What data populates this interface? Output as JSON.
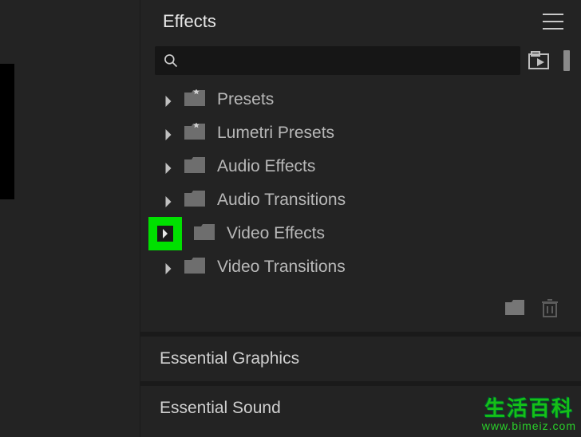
{
  "panel": {
    "title": "Effects",
    "search_placeholder": ""
  },
  "tree": [
    {
      "label": "Presets",
      "icon": "folder-star"
    },
    {
      "label": "Lumetri Presets",
      "icon": "folder-star"
    },
    {
      "label": "Audio Effects",
      "icon": "folder"
    },
    {
      "label": "Audio Transitions",
      "icon": "folder"
    },
    {
      "label": "Video Effects",
      "icon": "folder",
      "highlighted": true
    },
    {
      "label": "Video Transitions",
      "icon": "folder"
    }
  ],
  "collapsed_panels": [
    "Essential Graphics",
    "Essential Sound"
  ],
  "watermark": {
    "line1": "生活百科",
    "line2": "www.bimeiz.com"
  }
}
